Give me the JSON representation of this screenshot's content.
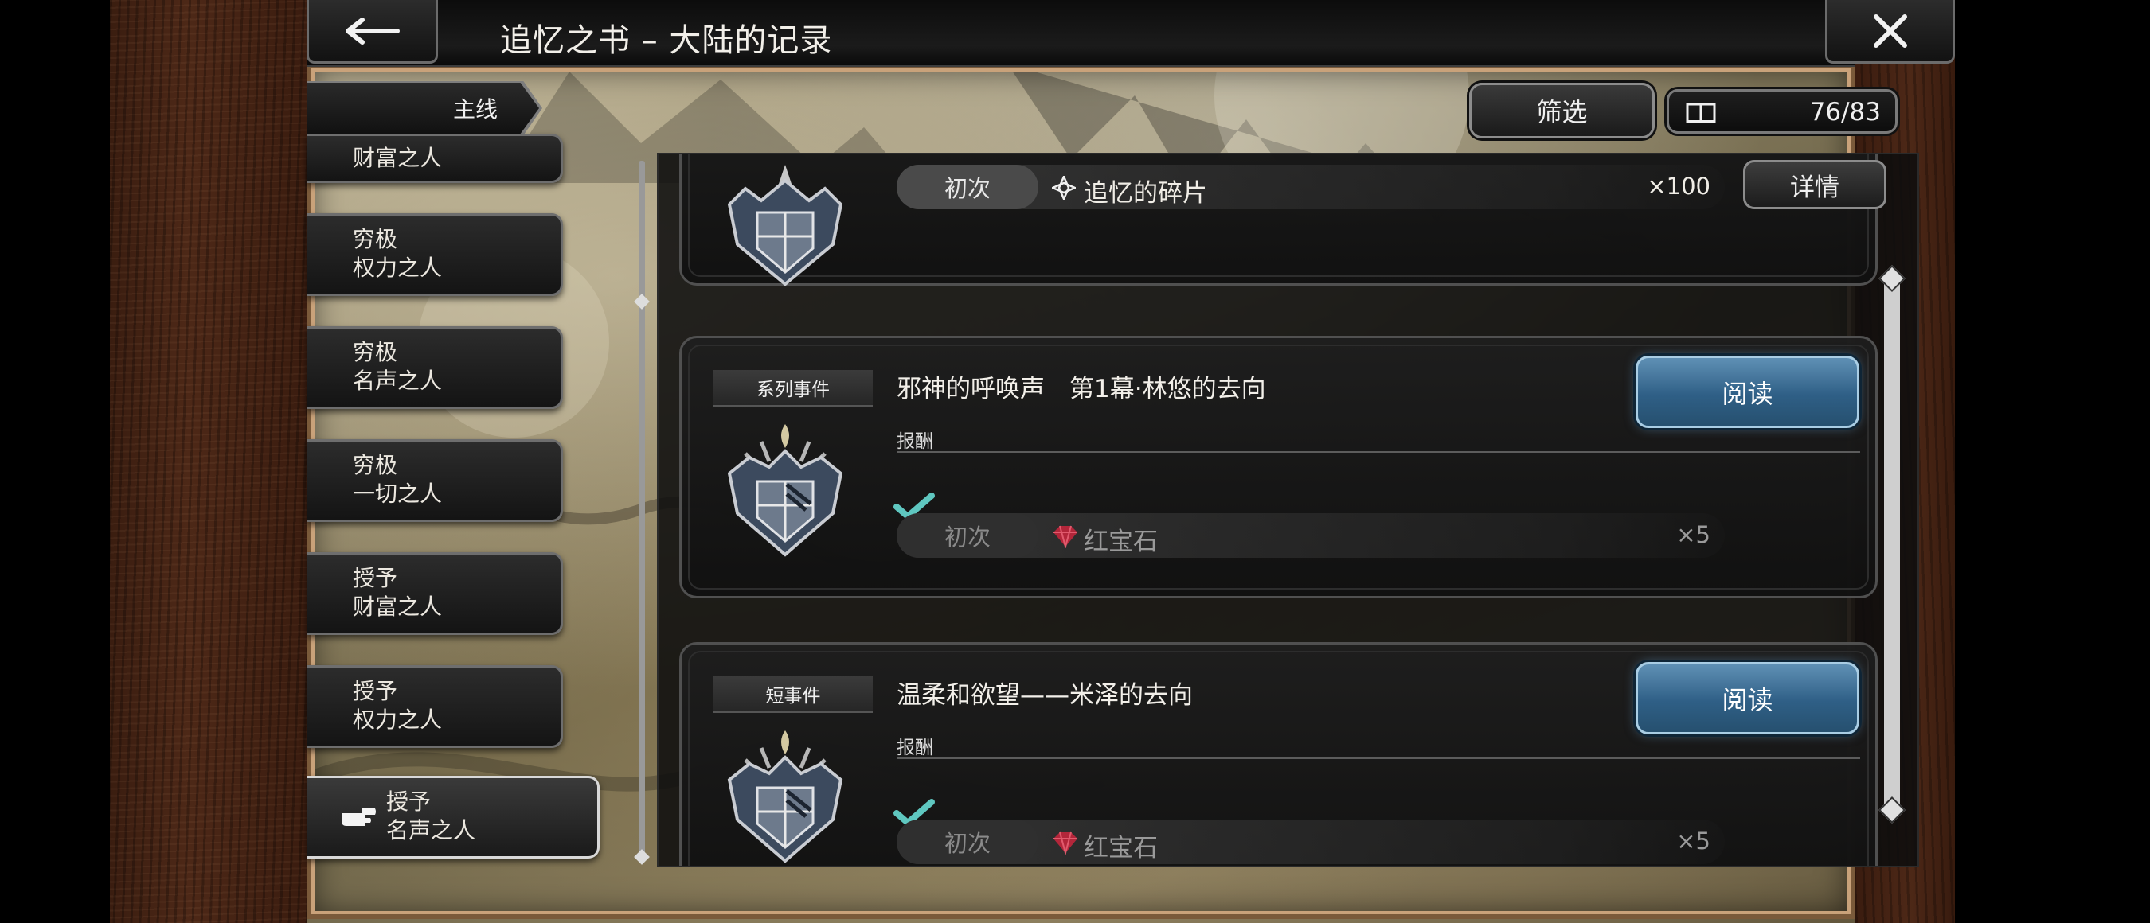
{
  "header": {
    "title": "追忆之书 – 大陆的记录",
    "back_icon": "left-arrow-icon",
    "close_icon": "close-x-icon"
  },
  "toolbar": {
    "filter_label": "筛选",
    "book_progress": "76/83"
  },
  "sidebar": {
    "category_tab": "主线",
    "items": [
      {
        "label": "财富之人"
      },
      {
        "label": "穷极\n权力之人"
      },
      {
        "label": "穷极\n名声之人"
      },
      {
        "label": "穷极\n一切之人"
      },
      {
        "label": "授予\n财富之人"
      },
      {
        "label": "授予\n权力之人"
      },
      {
        "label": "授予\n名声之人",
        "active": true
      }
    ]
  },
  "events": [
    {
      "tag": "",
      "title": "",
      "reward": {
        "first_label": "初次",
        "name": "追忆的碎片",
        "qty": "×100",
        "claimed": false
      },
      "detail_label": "详情"
    },
    {
      "tag": "系列事件",
      "title": "邪神的呼唤声　第1幕·林悠的去向",
      "read_label": "阅读",
      "reward_heading": "报酬",
      "reward": {
        "first_label": "初次",
        "name": "红宝石",
        "qty": "×5",
        "claimed": true
      }
    },
    {
      "tag": "短事件",
      "title": "温柔和欲望——米泽的去向",
      "read_label": "阅读",
      "reward_heading": "报酬",
      "reward": {
        "first_label": "初次",
        "name": "红宝石",
        "qty": "×5",
        "claimed": true
      }
    }
  ],
  "colors": {
    "accent_read_button": "#3a6d95",
    "check_mark": "#5fc7c0",
    "ruby": "#b3263a"
  }
}
